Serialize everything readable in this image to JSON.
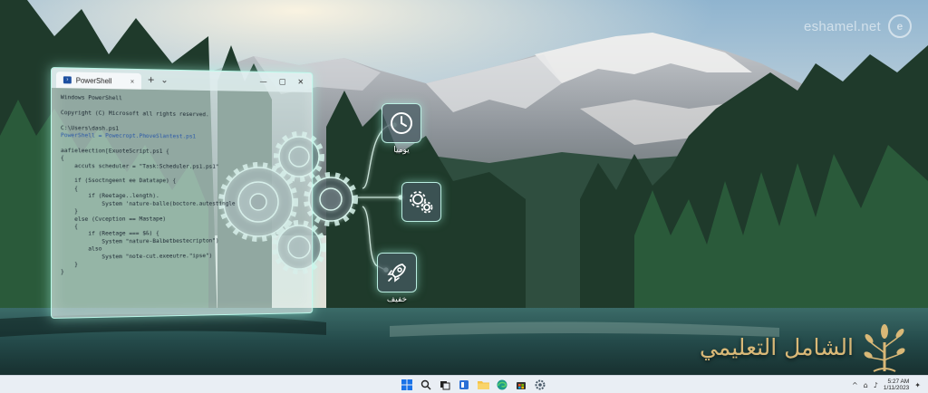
{
  "watermark": {
    "logo_letter": "e",
    "site": "eshamel.net"
  },
  "powershell": {
    "tab_title": "PowerShell",
    "new_tab": "+",
    "dropdown": "⌄",
    "controls": {
      "minimize": "—",
      "maximize": "▢",
      "close": "✕"
    },
    "lines": [
      "Windows PowerShell",
      "",
      "Copyright (C) Microsoft all rights reserved.",
      "",
      "C:\\Users\\dash.ps1",
      "PowerShell = Powecropt.PhoveSlantest.ps1",
      "",
      "aafieleection[ExuoteScript.ps1 {",
      "{",
      "    accuts scheduler = \"Task:Scheduler.ps1.ps1\"",
      "",
      "    if (Ssoctngeent ee Datatape) {",
      "    {",
      "        if (Reetage..length).",
      "            System 'nature-balle(boctore.autestingle",
      "    }",
      "    else (Cvception == Mastape)",
      "    {",
      "        if (Reetage === $&) {",
      "            System \"nature-Balbetbestecripton\")",
      "        also",
      "            System \"note-cut.exeeutre.\"ipse\")",
      "    }",
      "}"
    ]
  },
  "features": {
    "daily": {
      "label": "يوميا",
      "icon": "clock-icon"
    },
    "settings": {
      "icon": "gears-icon"
    },
    "light": {
      "label": "خفيف",
      "icon": "rocket-icon"
    }
  },
  "brand": {
    "text": "الشامل التعليمي"
  },
  "taskbar": {
    "apps": [
      "windows-start-icon",
      "search-icon",
      "task-view-icon",
      "widgets-icon",
      "file-explorer-icon",
      "edge-icon",
      "store-icon",
      "settings-icon"
    ],
    "tray": {
      "chevron": "^",
      "network": "⌂",
      "volume": "♪",
      "time": "5:27 AM",
      "date": "1/11/2023"
    }
  },
  "colors": {
    "glow": "#bfffee",
    "brand_gold": "#d9b877",
    "taskbar": "#e9eef4"
  }
}
